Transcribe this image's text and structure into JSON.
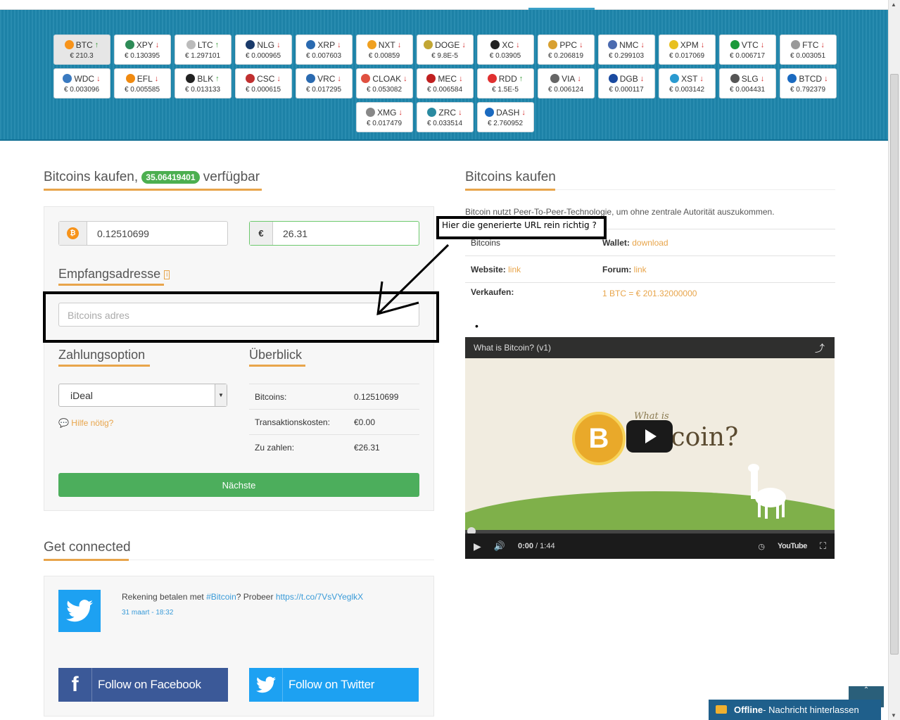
{
  "coins": [
    {
      "symbol": "BTC",
      "price": "€ 210.3",
      "trend": "up",
      "color": "#f7931a",
      "active": true
    },
    {
      "symbol": "XPY",
      "price": "€ 0.130395",
      "trend": "down",
      "color": "#2e8b57"
    },
    {
      "symbol": "LTC",
      "price": "€ 1.297101",
      "trend": "up",
      "color": "#bbbbbb"
    },
    {
      "symbol": "NLG",
      "price": "€ 0.000965",
      "trend": "down",
      "color": "#1a3a6a"
    },
    {
      "symbol": "XRP",
      "price": "€ 0.007603",
      "trend": "down",
      "color": "#2a6ab0"
    },
    {
      "symbol": "NXT",
      "price": "€ 0.00859",
      "trend": "down",
      "color": "#f0a020"
    },
    {
      "symbol": "DOGE",
      "price": "€ 9.8E-5",
      "trend": "down",
      "color": "#c2a633"
    },
    {
      "symbol": "XC",
      "price": "€ 0.03905",
      "trend": "down",
      "color": "#222222"
    },
    {
      "symbol": "PPC",
      "price": "€ 0.206819",
      "trend": "down",
      "color": "#d8a030"
    },
    {
      "symbol": "NMC",
      "price": "€ 0.299103",
      "trend": "down",
      "color": "#4a6ab0"
    },
    {
      "symbol": "XPM",
      "price": "€ 0.017069",
      "trend": "down",
      "color": "#e8c020"
    },
    {
      "symbol": "VTC",
      "price": "€ 0.006717",
      "trend": "down",
      "color": "#1b9a3a"
    },
    {
      "symbol": "FTC",
      "price": "€ 0.003051",
      "trend": "down",
      "color": "#999999"
    },
    {
      "symbol": "WDC",
      "price": "€ 0.003096",
      "trend": "down",
      "color": "#3a7ac0"
    },
    {
      "symbol": "EFL",
      "price": "€ 0.005585",
      "trend": "down",
      "color": "#f08a10"
    },
    {
      "symbol": "BLK",
      "price": "€ 0.013133",
      "trend": "up",
      "color": "#222222"
    },
    {
      "symbol": "CSC",
      "price": "€ 0.000615",
      "trend": "down",
      "color": "#c03030"
    },
    {
      "symbol": "VRC",
      "price": "€ 0.017295",
      "trend": "down",
      "color": "#2a6ab0"
    },
    {
      "symbol": "CLOAK",
      "price": "€ 0.053082",
      "trend": "down",
      "color": "#e05040"
    },
    {
      "symbol": "MEC",
      "price": "€ 0.006584",
      "trend": "down",
      "color": "#c02020"
    },
    {
      "symbol": "RDD",
      "price": "€ 1.5E-5",
      "trend": "up",
      "color": "#e03030"
    },
    {
      "symbol": "VIA",
      "price": "€ 0.006124",
      "trend": "down",
      "color": "#666666"
    },
    {
      "symbol": "DGB",
      "price": "€ 0.000117",
      "trend": "down",
      "color": "#1a4aa0"
    },
    {
      "symbol": "XST",
      "price": "€ 0.003142",
      "trend": "down",
      "color": "#2a9ad0"
    },
    {
      "symbol": "SLG",
      "price": "€ 0.004431",
      "trend": "down",
      "color": "#555555"
    },
    {
      "symbol": "BTCD",
      "price": "€ 0.792379",
      "trend": "down",
      "color": "#1a6ac0"
    },
    {
      "symbol": "XMG",
      "price": "€ 0.017479",
      "trend": "down",
      "color": "#888888"
    },
    {
      "symbol": "ZRC",
      "price": "€ 0.033514",
      "trend": "down",
      "color": "#2a8aa0"
    },
    {
      "symbol": "DASH",
      "price": "€ 2.760952",
      "trend": "down",
      "color": "#1a6ac0"
    }
  ],
  "buy_section": {
    "title_prefix": "Bitcoins kaufen,",
    "available_badge": "35.06419401",
    "title_suffix": "verfügbar",
    "btc_amount": "0.12510699",
    "eur_symbol": "€",
    "eur_amount": "26.31",
    "address_heading": "Empfangsadresse",
    "address_placeholder": "Bitcoins adres",
    "payment_heading": "Zahlungsoption",
    "payment_selected": "iDeal",
    "help_text": "Hilfe nötig?",
    "overview_heading": "Überblick",
    "overview_rows": [
      {
        "label": "Bitcoins:",
        "value": "0.12510699"
      },
      {
        "label": "Transaktionskosten:",
        "value": "€0.00"
      },
      {
        "label": "Zu zahlen:",
        "value": "€26.31"
      }
    ],
    "next_button": "Nächste"
  },
  "annotation": {
    "label": "Hier die generierte URL rein richtig ?"
  },
  "info_section": {
    "title": "Bitcoins kaufen",
    "description": "Bitcoin nutzt Peer-To-Peer-Technologie, um ohne zentrale Autorität auszukommen.",
    "row1_left": "Bitcoins",
    "wallet_label": "Wallet:",
    "wallet_link": "download",
    "website_label": "Website:",
    "website_link": "link",
    "forum_label": "Forum:",
    "forum_link": "link",
    "sell_label": "Verkaufen:",
    "sell_rate": "1 BTC = € 201.32000000",
    "bullet": "•"
  },
  "video": {
    "title": "What is Bitcoin? (v1)",
    "overlay_small": "What is",
    "overlay_big": "Bitcoin?",
    "time": "0:00",
    "duration": "/ 1:44",
    "youtube": "YouTube"
  },
  "connect": {
    "title": "Get connected",
    "tweet_prefix": "Rekening betalen met ",
    "tweet_hashtag": "#Bitcoin",
    "tweet_middle": "? Probeer ",
    "tweet_link": "https://t.co/7VsVYeglkX",
    "tweet_date": "31 maart - 18:32",
    "facebook_button": "Follow on Facebook",
    "twitter_button": "Follow on Twitter"
  },
  "chat_widget": {
    "label_bold": "Offline",
    "label_rest": " - Nachricht hinterlassen"
  }
}
